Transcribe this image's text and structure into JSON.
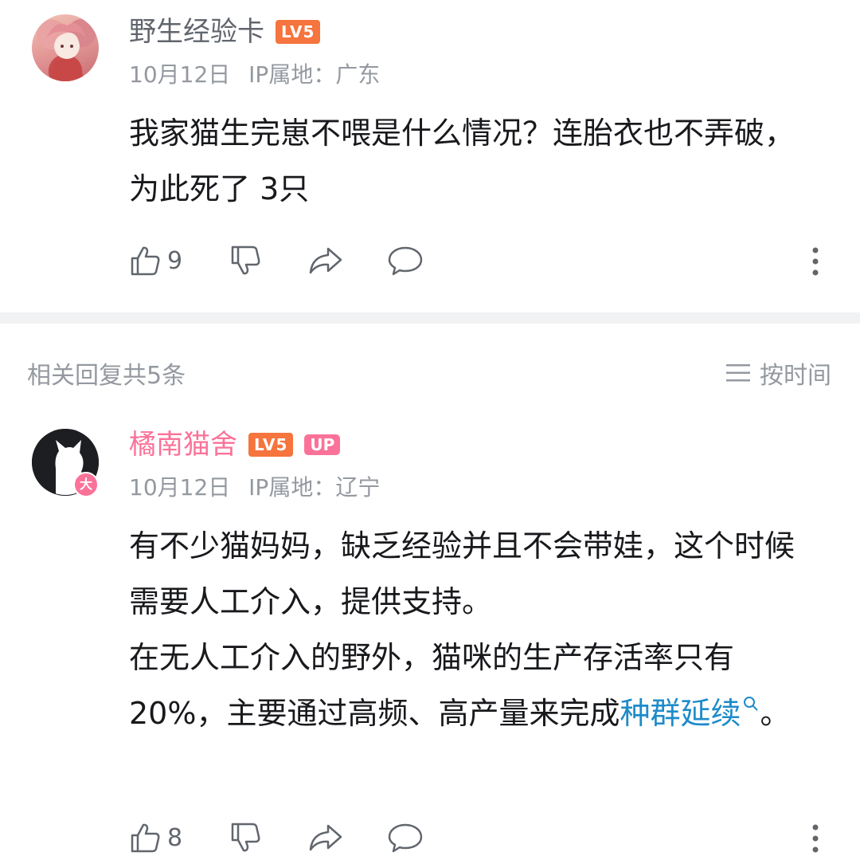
{
  "comment": {
    "username": "野生经验卡",
    "level": "LV5",
    "date": "10月12日",
    "ip_location": "IP属地：广东",
    "content": "我家猫生完崽不喂是什么情况？连胎衣也不弄破，为此死了 3只",
    "like_count": "9"
  },
  "replies_header": {
    "title": "相关回复共5条",
    "sort_label": "按时间"
  },
  "reply": {
    "username": "橘南猫舍",
    "level": "LV5",
    "up_badge": "UP",
    "avatar_badge": "大",
    "date": "10月12日",
    "ip_location": "IP属地：辽宁",
    "paragraph1": "有不少猫妈妈，缺乏经验并且不会带娃，这个时候需要人工介入，提供支持。",
    "paragraph2_text": "在无人工介入的野外，猫咪的生产存活率只有20%，主要通过高频、高产量来完成",
    "link_text": "种群延续",
    "paragraph2_end": "。",
    "like_count": "8"
  },
  "colors": {
    "accent_pink": "#fb7299",
    "level_orange": "#f6743d",
    "link_blue": "#1e8bc9",
    "meta_gray": "#9499a0"
  }
}
